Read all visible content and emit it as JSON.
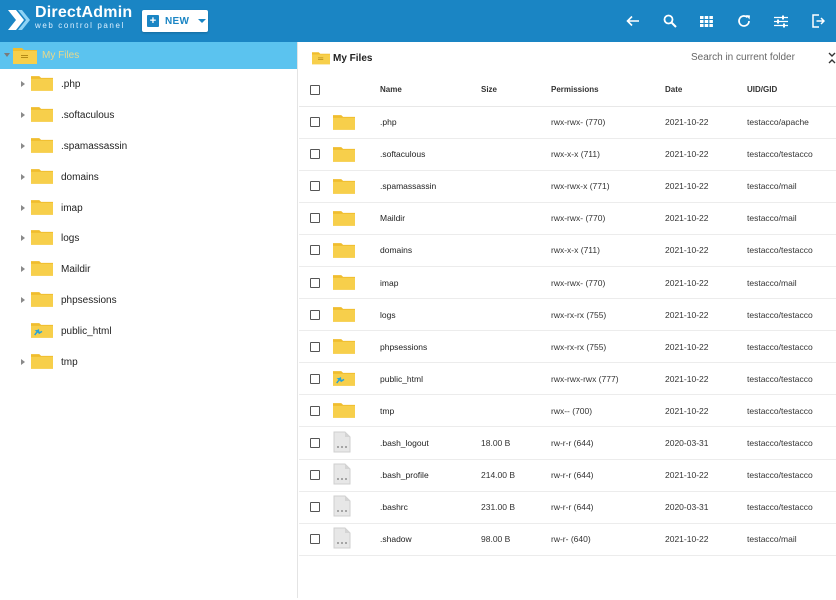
{
  "app": {
    "logo_title": "DirectAdmin",
    "logo_subtitle": "web control panel",
    "new_button_label": "NEW",
    "brand_color": "#1a85c4",
    "toolbar_icons": [
      "back-arrow-icon",
      "search-icon",
      "grid-view-icon",
      "refresh-icon",
      "settings-sliders-icon",
      "logout-icon"
    ]
  },
  "sidebar": {
    "root_label": "My Files",
    "items": [
      {
        "label": ".php",
        "icon": "folder-icon",
        "expandable": true
      },
      {
        "label": ".softaculous",
        "icon": "folder-icon",
        "expandable": true
      },
      {
        "label": ".spamassassin",
        "icon": "folder-icon",
        "expandable": true
      },
      {
        "label": "domains",
        "icon": "folder-icon",
        "expandable": true
      },
      {
        "label": "imap",
        "icon": "folder-icon",
        "expandable": true
      },
      {
        "label": "logs",
        "icon": "folder-icon",
        "expandable": true
      },
      {
        "label": "Maildir",
        "icon": "folder-icon",
        "expandable": true
      },
      {
        "label": "phpsessions",
        "icon": "folder-icon",
        "expandable": true
      },
      {
        "label": "public_html",
        "icon": "public-folder-icon",
        "expandable": false
      },
      {
        "label": "tmp",
        "icon": "folder-icon",
        "expandable": true
      }
    ]
  },
  "main": {
    "title": "My Files",
    "search_placeholder": "Search in current folder",
    "columns": {
      "name": "Name",
      "size": "Size",
      "permissions": "Permissions",
      "date": "Date",
      "uid": "UID/GID"
    },
    "rows": [
      {
        "name": ".php",
        "type": "folder",
        "size": "",
        "permissions": "rwx-rwx- (770)",
        "date": "2021-10-22",
        "uid": "testacco/apache"
      },
      {
        "name": ".softaculous",
        "type": "folder",
        "size": "",
        "permissions": "rwx-x-x (711)",
        "date": "2021-10-22",
        "uid": "testacco/testacco"
      },
      {
        "name": ".spamassassin",
        "type": "folder",
        "size": "",
        "permissions": "rwx-rwx-x (771)",
        "date": "2021-10-22",
        "uid": "testacco/mail"
      },
      {
        "name": "Maildir",
        "type": "folder",
        "size": "",
        "permissions": "rwx-rwx- (770)",
        "date": "2021-10-22",
        "uid": "testacco/mail"
      },
      {
        "name": "domains",
        "type": "folder",
        "size": "",
        "permissions": "rwx-x-x (711)",
        "date": "2021-10-22",
        "uid": "testacco/testacco"
      },
      {
        "name": "imap",
        "type": "folder",
        "size": "",
        "permissions": "rwx-rwx- (770)",
        "date": "2021-10-22",
        "uid": "testacco/mail"
      },
      {
        "name": "logs",
        "type": "folder",
        "size": "",
        "permissions": "rwx-rx-rx (755)",
        "date": "2021-10-22",
        "uid": "testacco/testacco"
      },
      {
        "name": "phpsessions",
        "type": "folder",
        "size": "",
        "permissions": "rwx-rx-rx (755)",
        "date": "2021-10-22",
        "uid": "testacco/testacco"
      },
      {
        "name": "public_html",
        "type": "public-folder",
        "size": "",
        "permissions": "rwx-rwx-rwx (777)",
        "date": "2021-10-22",
        "uid": "testacco/testacco"
      },
      {
        "name": "tmp",
        "type": "folder",
        "size": "",
        "permissions": "rwx-- (700)",
        "date": "2021-10-22",
        "uid": "testacco/testacco"
      },
      {
        "name": ".bash_logout",
        "type": "file",
        "size": "18.00 B",
        "permissions": "rw-r-r (644)",
        "date": "2020-03-31",
        "uid": "testacco/testacco"
      },
      {
        "name": ".bash_profile",
        "type": "file",
        "size": "214.00 B",
        "permissions": "rw-r-r (644)",
        "date": "2021-10-22",
        "uid": "testacco/testacco"
      },
      {
        "name": ".bashrc",
        "type": "file",
        "size": "231.00 B",
        "permissions": "rw-r-r (644)",
        "date": "2020-03-31",
        "uid": "testacco/testacco"
      },
      {
        "name": ".shadow",
        "type": "file",
        "size": "98.00 B",
        "permissions": "rw-r- (640)",
        "date": "2021-10-22",
        "uid": "testacco/mail"
      }
    ]
  }
}
